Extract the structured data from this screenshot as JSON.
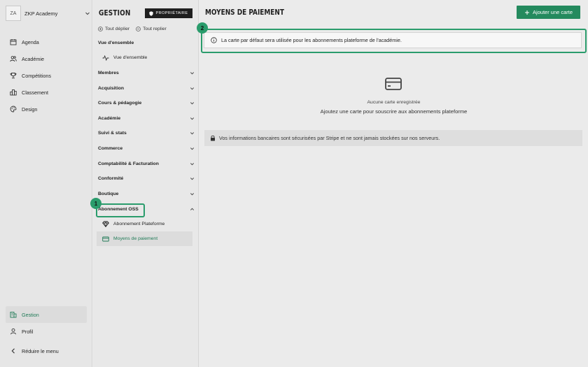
{
  "nav": {
    "org_initials": "ZA",
    "org_name": "ZKP Academy",
    "items": [
      {
        "label": "Agenda",
        "icon": "calendar-icon"
      },
      {
        "label": "Académie",
        "icon": "users-icon"
      },
      {
        "label": "Compétitions",
        "icon": "trophy-icon"
      },
      {
        "label": "Classement",
        "icon": "podium-icon"
      },
      {
        "label": "Design",
        "icon": "palette-icon"
      }
    ],
    "bottom": [
      {
        "label": "Gestion",
        "icon": "building-icon"
      },
      {
        "label": "Profil",
        "icon": "user-icon"
      },
      {
        "label": "Réduire le menu",
        "icon": "chevron-left-icon"
      }
    ]
  },
  "gestion": {
    "title": "GESTION",
    "owner_badge": "PROPRIÉTAIRE",
    "expand_all": "Tout déplier",
    "collapse_all": "Tout replier",
    "overview_section": "Vue d'ensemble",
    "overview_item": "Vue d'ensemble",
    "sections": [
      "Membres",
      "Acquisition",
      "Cours & pédagogie",
      "Académie",
      "Suivi & stats",
      "Commerce",
      "Comptabilité & Facturation",
      "Conformité",
      "Boutique"
    ],
    "oss_section": "Abonnement OSS",
    "oss_items": [
      "Abonnement Plateforme",
      "Moyens de paiement"
    ]
  },
  "main": {
    "title": "MOYENS DE PAIEMENT",
    "add_button": "Ajouter une carte",
    "info_text": "La carte par défaut sera utilisée pour les abonnements plateforme de l'académie.",
    "empty_title": "Aucune carte enregistrée",
    "empty_subtitle": "Ajoutez une carte pour souscrire aux abonnements plateforme",
    "secure_text": "Vos informations bancaires sont sécurisées par Stripe et ne sont jamais stockées sur nos serveurs."
  },
  "highlights": [
    "1",
    "2"
  ],
  "colors": {
    "accent": "#248a5e",
    "highlight": "#2a9c6c"
  }
}
